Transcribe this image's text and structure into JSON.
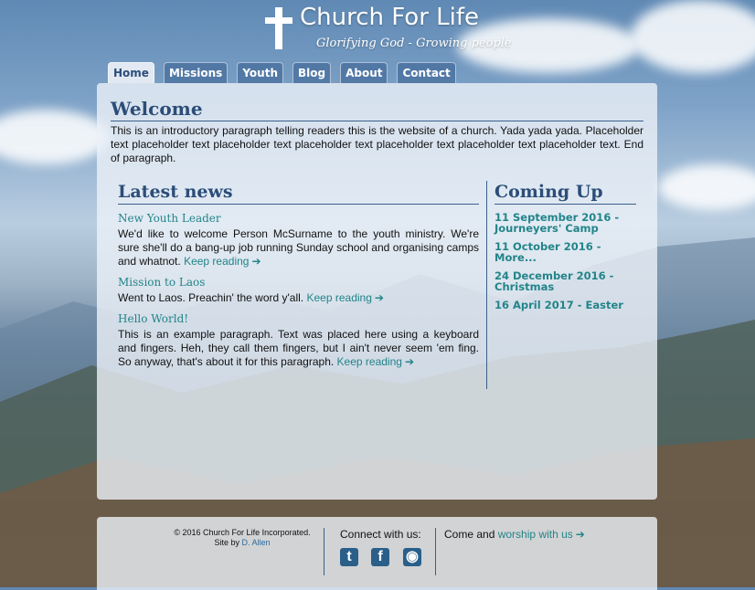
{
  "site": {
    "title": "Church For Life",
    "tagline": "Glorifying God - Growing people"
  },
  "nav": {
    "tabs": [
      {
        "label": "Home",
        "active": true
      },
      {
        "label": "Missions",
        "active": false
      },
      {
        "label": "Youth",
        "active": false
      },
      {
        "label": "Blog",
        "active": false
      },
      {
        "label": "About",
        "active": false
      },
      {
        "label": "Contact",
        "active": false
      }
    ]
  },
  "welcome": {
    "title": "Welcome",
    "text": "This is an introductory paragraph telling readers this is the website of a church. Yada yada yada. Placeholder text placeholder text placeholder text placeholder text placeholder text placeholder text placeholder text. End of paragraph."
  },
  "news": {
    "heading": "Latest news",
    "articles": [
      {
        "title": "New Youth Leader",
        "text": "We'd like to welcome Person McSurname to the youth ministry. We're sure she'll do a bang-up job running Sunday school and organising camps and whatnot.",
        "link": "Keep reading"
      },
      {
        "title": "Mission to Laos",
        "text": "Went to Laos. Preachin' the word y'all.",
        "link": "Keep reading"
      },
      {
        "title": "Hello World!",
        "text": "This is an example paragraph. Text was placed here using a keyboard and fingers. Heh, they call them fingers, but I ain't never seem 'em fing. So anyway, that's about it for this paragraph.",
        "link": "Keep reading"
      }
    ]
  },
  "events": {
    "heading": "Coming Up",
    "items": [
      "11 September 2016 - Journeyers' Camp",
      "11 October 2016 - More...",
      "24 December 2016 - Christmas",
      "16 April 2017 - Easter"
    ]
  },
  "footer": {
    "copyright": "© 2016 Church For Life Incorporated.",
    "site_by": "Site by",
    "author": "D. Allen",
    "connect_label": "Connect with us:",
    "social": [
      {
        "icon": "twitter-icon",
        "glyph": "t"
      },
      {
        "icon": "facebook-icon",
        "glyph": "f"
      },
      {
        "icon": "rss-icon",
        "glyph": "◉"
      }
    ],
    "worship_prefix": "Come and",
    "worship_link": "worship with us"
  },
  "colors": {
    "heading": "#2b4d78",
    "link": "#22848a",
    "panel": "#ecf1f7"
  }
}
